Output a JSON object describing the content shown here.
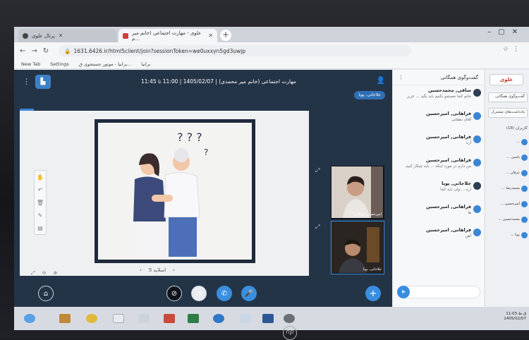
{
  "browser": {
    "tabs": [
      {
        "label": "پرتال علوی",
        "active": false
      },
      {
        "label": "علوی - مهارت اجتماعی (خانم میر م...",
        "active": true
      }
    ],
    "url": "1631.6426.ir/html5client/join?sessionToken=we0uxxyn5gd3uwjp",
    "bookmarks": [
      "New Tab",
      "Settings",
      "برانیا - موتور جستجوی ق...",
      "برانیا"
    ]
  },
  "meeting": {
    "title": "مهارت اجتماعی (خانم میر محمدی) | 1405/02/07 | 11:00 تا 11:45",
    "presenter_chip": "جلاجانی, پویا",
    "slide_nav_label": "اسلاید 5",
    "cams": [
      {
        "label": "امیرحسین فراهانی"
      },
      {
        "label": "جلاجانی, پویا"
      }
    ]
  },
  "chat": {
    "header_title": "گفت‌وگوی همگانی",
    "messages": [
      {
        "name": "ساقی, محمدحسین",
        "text": "خانم کجا جستجو بکنیم باید بگید ... عزیز"
      },
      {
        "name": "فراهانی, امیرحسین",
        "text": "آقای دهقانی"
      },
      {
        "name": "فراهانی, امیرحسین",
        "text": "آره"
      },
      {
        "name": "فراهانی, امیرحسین",
        "text": "من دارم در مورد اینکه ... باید چیکار کنیم"
      },
      {
        "name": "جلاجانی, پویا",
        "text": "اره ... ولی باید کجا"
      },
      {
        "name": "فراهانی, امیرحسین",
        "text": "ها"
      },
      {
        "name": "فراهانی, امیرحسین",
        "text": "آهن"
      }
    ]
  },
  "userlist": {
    "logo": "علوی",
    "items": [
      "گفت‌وگوی همگانی",
      "یادداشت‌های مشترک",
      "کاربران (18)"
    ],
    "users": [
      "...",
      "یاسین ...",
      "عرفان ...",
      "محمدرضا ...",
      "امیرحسین ...",
      "محمدحسین ...",
      "پویا ..."
    ]
  },
  "taskbar": {
    "time": "11:03 ق.ظ",
    "date": "1405/02/07"
  }
}
